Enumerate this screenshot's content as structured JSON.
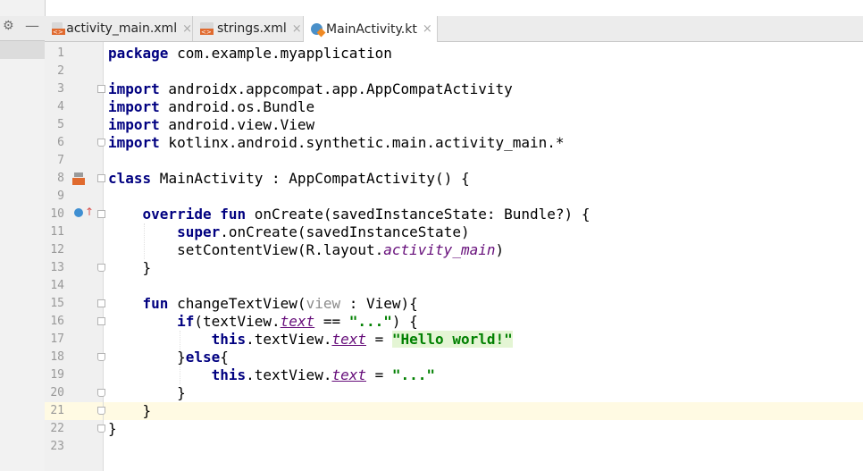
{
  "tabs": [
    {
      "label": "activity_main.xml",
      "icon": "xml-file-icon",
      "active": false
    },
    {
      "label": "strings.xml",
      "icon": "xml-file-icon",
      "active": false
    },
    {
      "label": "MainActivity.kt",
      "icon": "kotlin-file-icon",
      "active": true
    }
  ],
  "close_glyph": "×",
  "toolbar": {
    "gear": "⚙",
    "minus": "—"
  },
  "line_numbers": [
    "1",
    "2",
    "3",
    "4",
    "5",
    "6",
    "7",
    "8",
    "9",
    "10",
    "11",
    "12",
    "13",
    "14",
    "15",
    "16",
    "17",
    "18",
    "19",
    "20",
    "21",
    "22",
    "23"
  ],
  "code": {
    "l1": {
      "kw": "package",
      "rest": " com.example.myapplication"
    },
    "l3": {
      "kw": "import",
      "rest": " androidx.appcompat.app.AppCompatActivity"
    },
    "l4": {
      "kw": "import",
      "rest": " android.os.Bundle"
    },
    "l5": {
      "kw": "import",
      "rest": " android.view.View"
    },
    "l6": {
      "kw": "import",
      "rest": " kotlinx.android.synthetic.main.activity_main.*"
    },
    "l8": {
      "kw": "class",
      "rest": " MainActivity : AppCompatActivity() {"
    },
    "l10": {
      "indent": "    ",
      "kw1": "override",
      "sp": " ",
      "kw2": "fun",
      "rest": " onCreate(savedInstanceState: Bundle?) {"
    },
    "l11": {
      "indent": "        ",
      "kw": "super",
      "rest": ".onCreate(savedInstanceState)"
    },
    "l12": {
      "indent": "        ",
      "pre": "setContentView(R.layout.",
      "prop": "activity_main",
      "post": ")"
    },
    "l13": {
      "text": "    }"
    },
    "l15": {
      "indent": "    ",
      "kw": "fun",
      "pre": " changeTextView(",
      "param": "view",
      "post": " : View){"
    },
    "l16": {
      "indent": "        ",
      "kw": "if",
      "pre": "(textView.",
      "syn": "text",
      "mid": " == ",
      "str": "\"...\"",
      "post": ") {"
    },
    "l17": {
      "indent": "            ",
      "kw": "this",
      "pre": ".textView.",
      "syn": "text",
      "mid": " = ",
      "str": "\"Hello world!\""
    },
    "l18": {
      "indent": "        ",
      "pre": "}",
      "kw": "else",
      "post": "{"
    },
    "l19": {
      "indent": "            ",
      "kw": "this",
      "pre": ".textView.",
      "syn": "text",
      "mid": " = ",
      "str": "\"...\""
    },
    "l20": {
      "text": "        }"
    },
    "l21": {
      "text": "    }"
    },
    "l22": {
      "text": "}"
    }
  },
  "colors": {
    "keyword": "#000080",
    "string": "#008000",
    "property": "#660e7a",
    "current_line": "#fffae3"
  }
}
